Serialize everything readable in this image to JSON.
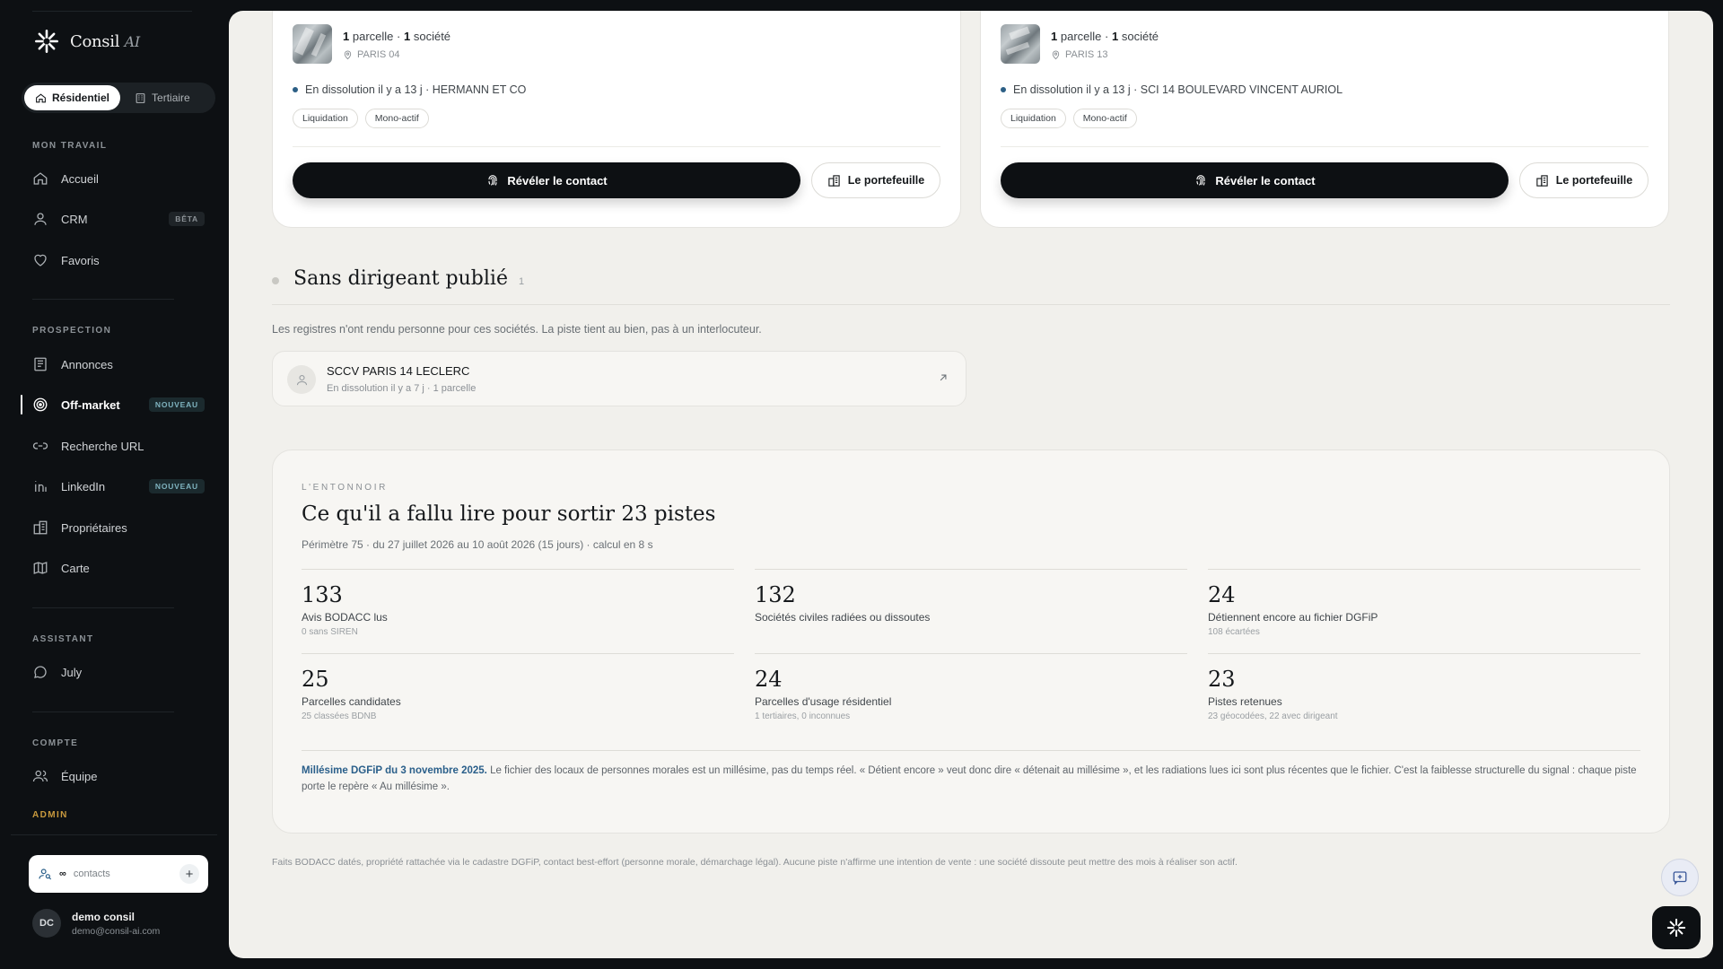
{
  "brand": {
    "name": "Consil",
    "suffix": "AI"
  },
  "segment": {
    "residential": "Résidentiel",
    "tertiary": "Tertiaire"
  },
  "sidebar": {
    "sections": {
      "work": "MON TRAVAIL",
      "prospection": "PROSPECTION",
      "assistant": "ASSISTANT",
      "account": "COMPTE",
      "admin": "ADMIN"
    },
    "items": {
      "home": "Accueil",
      "crm": "CRM",
      "crm_badge": "BÊTA",
      "favorites": "Favoris",
      "listings": "Annonces",
      "offmarket": "Off-market",
      "offmarket_badge": "NOUVEAU",
      "url_search": "Recherche URL",
      "linkedin": "LinkedIn",
      "linkedin_badge": "NOUVEAU",
      "owners": "Propriétaires",
      "map": "Carte",
      "july": "July",
      "team": "Équipe"
    },
    "contacts": {
      "count": "∞",
      "label": "contacts"
    },
    "user": {
      "initials": "DC",
      "name": "demo consil",
      "email": "demo@consil-ai.com"
    }
  },
  "cards": [
    {
      "parcels_count": "1",
      "parcels_label": "parcelle",
      "sep": "·",
      "companies_count": "1",
      "companies_label": "société",
      "location": "PARIS 04",
      "dissolution": "En dissolution il y a 13 j · HERMANN ET CO",
      "tags": [
        "Liquidation",
        "Mono-actif"
      ],
      "reveal_label": "Révéler le contact",
      "portfolio_label": "Le portefeuille"
    },
    {
      "parcels_count": "1",
      "parcels_label": "parcelle",
      "sep": "·",
      "companies_count": "1",
      "companies_label": "société",
      "location": "PARIS 13",
      "dissolution": "En dissolution il y a 13 j · SCI 14 BOULEVARD VINCENT AURIOL",
      "tags": [
        "Liquidation",
        "Mono-actif"
      ],
      "reveal_label": "Révéler le contact",
      "portfolio_label": "Le portefeuille"
    }
  ],
  "no_director": {
    "title": "Sans dirigeant publié",
    "count": "1",
    "description": "Les registres n'ont rendu personne pour ces sociétés. La piste tient au bien, pas à un interlocuteur.",
    "company": {
      "name": "SCCV PARIS 14 LECLERC",
      "sub": "En dissolution il y a 7 j · 1 parcelle"
    }
  },
  "funnel": {
    "kicker": "L'ENTONNOIR",
    "title": "Ce qu'il a fallu lire pour sortir 23 pistes",
    "subtitle": "Périmètre 75 · du 27 juillet 2026 au 10 août 2026 (15 jours) · calcul en 8 s",
    "stats": [
      {
        "value": "133",
        "label": "Avis BODACC lus",
        "sub": "0 sans SIREN"
      },
      {
        "value": "132",
        "label": "Sociétés civiles radiées ou dissoutes",
        "sub": ""
      },
      {
        "value": "24",
        "label": "Détiennent encore au fichier DGFiP",
        "sub": "108 écartées"
      },
      {
        "value": "25",
        "label": "Parcelles candidates",
        "sub": "25 classées BDNB"
      },
      {
        "value": "24",
        "label": "Parcelles d'usage résidentiel",
        "sub": "1 tertiaires, 0 inconnues"
      },
      {
        "value": "23",
        "label": "Pistes retenues",
        "sub": "23 géocodées, 22 avec dirigeant"
      }
    ],
    "note_strong": "Millésime DGFiP du 3 novembre 2025.",
    "note_text": " Le fichier des locaux de personnes morales est un millésime, pas du temps réel. « Détient encore » veut donc dire « détenait au millésime », et les radiations lues ici sont plus récentes que le fichier. C'est la faiblesse structurelle du signal : chaque piste porte le repère « Au millésime »."
  },
  "disclaimer": "Faits BODACC datés, propriété rattachée via le cadastre DGFiP, contact best-effort (personne morale, démarchage légal). Aucune piste n'affirme une intention de vente : une société dissoute peut mettre des mois à réaliser son actif.",
  "colors": {
    "accent": "#2a5f8a",
    "sidebar": "#0d1013",
    "canvas": "#f1f0ec"
  }
}
